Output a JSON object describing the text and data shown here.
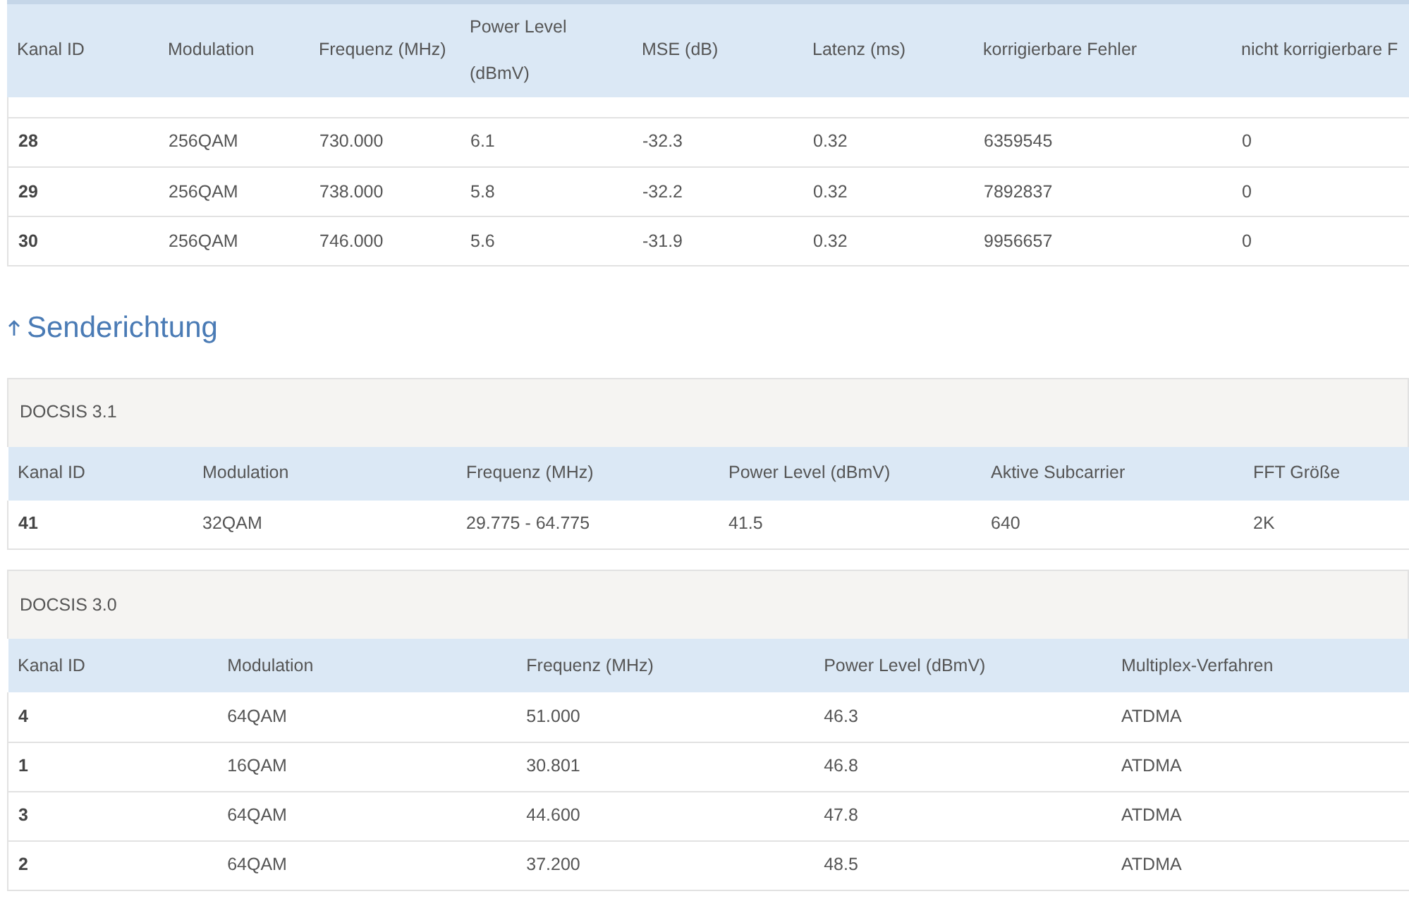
{
  "downstream_table": {
    "columns": [
      "Kanal ID",
      "Modulation",
      "Frequenz (MHz)",
      "Power Level (dBmV)",
      "MSE (dB)",
      "Latenz (ms)",
      "korrigierbare Fehler",
      "nicht korrigierbare F"
    ],
    "rows": [
      [
        "28",
        "256QAM",
        "730.000",
        "6.1",
        "-32.3",
        "0.32",
        "6359545",
        "0"
      ],
      [
        "29",
        "256QAM",
        "738.000",
        "5.8",
        "-32.2",
        "0.32",
        "7892837",
        "0"
      ],
      [
        "30",
        "256QAM",
        "746.000",
        "5.6",
        "-31.9",
        "0.32",
        "9956657",
        "0"
      ]
    ]
  },
  "section_heading": "Senderichtung",
  "upstream_groups": [
    {
      "title": "DOCSIS 3.1",
      "columns": [
        "Kanal ID",
        "Modulation",
        "Frequenz (MHz)",
        "Power Level (dBmV)",
        "Aktive Subcarrier",
        "FFT Größe"
      ],
      "rows": [
        [
          "41",
          "32QAM",
          "29.775 - 64.775",
          "41.5",
          "640",
          "2K"
        ]
      ]
    },
    {
      "title": "DOCSIS 3.0",
      "columns": [
        "Kanal ID",
        "Modulation",
        "Frequenz (MHz)",
        "Power Level (dBmV)",
        "Multiplex-Verfahren"
      ],
      "rows": [
        [
          "4",
          "64QAM",
          "51.000",
          "46.3",
          "ATDMA"
        ],
        [
          "1",
          "16QAM",
          "30.801",
          "46.8",
          "ATDMA"
        ],
        [
          "3",
          "64QAM",
          "44.600",
          "47.8",
          "ATDMA"
        ],
        [
          "2",
          "64QAM",
          "37.200",
          "48.5",
          "ATDMA"
        ]
      ]
    }
  ]
}
